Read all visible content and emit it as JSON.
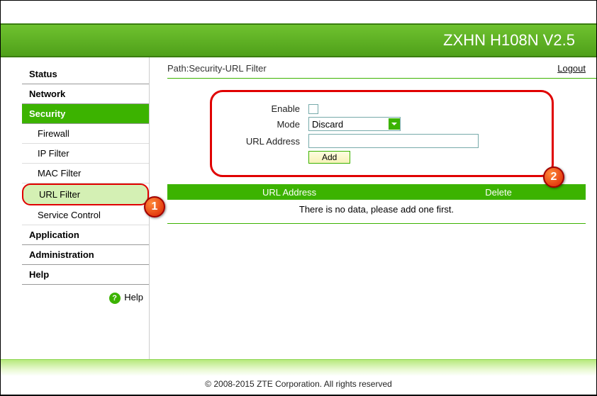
{
  "header": {
    "title": "ZXHN H108N V2.5"
  },
  "sidebar": {
    "items": [
      {
        "label": "Status",
        "type": "top"
      },
      {
        "label": "Network",
        "type": "top"
      },
      {
        "label": "Security",
        "type": "top-active"
      },
      {
        "label": "Firewall",
        "type": "sub"
      },
      {
        "label": "IP Filter",
        "type": "sub"
      },
      {
        "label": "MAC Filter",
        "type": "sub"
      },
      {
        "label": "URL Filter",
        "type": "sub-active"
      },
      {
        "label": "Service Control",
        "type": "sub"
      },
      {
        "label": "Application",
        "type": "top"
      },
      {
        "label": "Administration",
        "type": "top"
      },
      {
        "label": "Help",
        "type": "top"
      }
    ],
    "help_label": "Help"
  },
  "content": {
    "path_label": "Path:Security-URL Filter",
    "logout": "Logout",
    "form": {
      "enable_label": "Enable",
      "mode_label": "Mode",
      "mode_value": "Discard",
      "url_label": "URL Address",
      "url_value": "",
      "add_btn": "Add"
    },
    "table": {
      "col1": "URL Address",
      "col2": "Delete",
      "empty_msg": "There is no data, please add one first."
    }
  },
  "callouts": {
    "one": "1",
    "two": "2"
  },
  "footer": "© 2008-2015 ZTE Corporation. All rights reserved"
}
